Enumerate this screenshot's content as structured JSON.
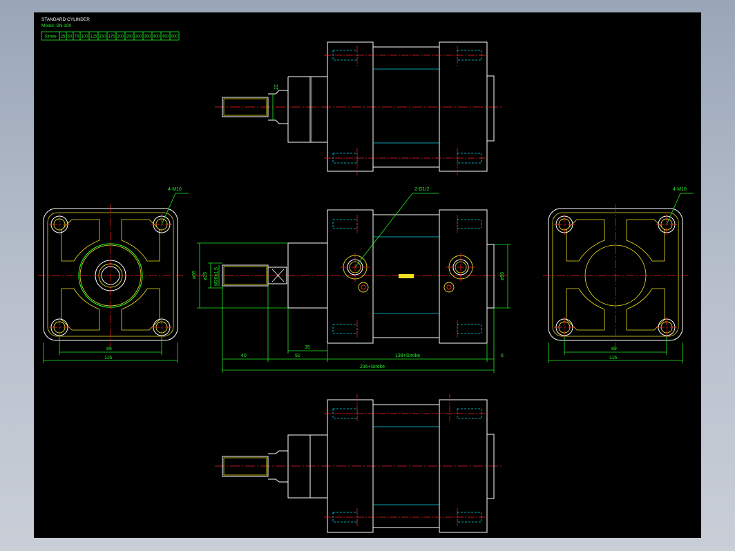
{
  "title_block": {
    "title": "STANDARD CYLINDER",
    "model": "Model: SN-100",
    "stroke_label": "Stroke",
    "strokes": [
      "25",
      "50",
      "75",
      "100",
      "125",
      "150",
      "175",
      "200",
      "250",
      "300",
      "350",
      "400",
      "450",
      "500"
    ]
  },
  "callouts": {
    "left_thread": "4-M10",
    "right_thread": "4-M10",
    "port": "2-G1/2"
  },
  "dims": {
    "rod_dia_top": "22",
    "left_w_inner": "89",
    "left_w_outer": "115",
    "right_w_inner": "89",
    "right_w_outer": "116",
    "d_35": "35",
    "d_40": "40",
    "d_51": "51",
    "d_138": "138+Stroke",
    "d_6": "6",
    "d_total": "236+Stroke",
    "dia_95_left": "ø95",
    "dia_25": "ø25",
    "thread_rod": "M20x1.5",
    "dia_95_right": "ø95"
  },
  "colors": {
    "background": "#000000",
    "outline": "#ffffff",
    "dimension": "#22ee22",
    "centerline": "#ff2020",
    "hidden": "#00d8e8",
    "yellow": "#f0e020"
  }
}
